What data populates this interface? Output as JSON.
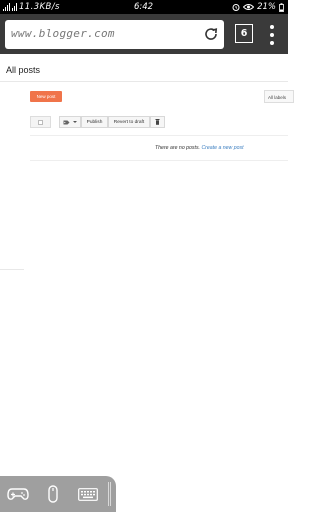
{
  "status_bar": {
    "speed": "11.3KB/s",
    "time": "6:42",
    "battery": "21%"
  },
  "browser": {
    "url": "www.blogger.com",
    "tab_count": "6"
  },
  "page": {
    "title": "All posts"
  },
  "actions": {
    "new_post": "New post",
    "all_labels": "All labels"
  },
  "toolbar": {
    "publish": "Publish",
    "revert": "Revert to draft"
  },
  "posts": {
    "empty_text": "There are no posts.",
    "create_link": "Create a new post"
  },
  "icons": {
    "reload": "reload-icon",
    "menu": "overflow-menu-icon",
    "label": "tag-icon",
    "trash": "trash-icon",
    "gamepad": "gamepad-icon",
    "mouse": "mouse-icon",
    "keyboard": "keyboard-icon"
  },
  "colors": {
    "new_post_button": "#f0744a",
    "link": "#3d7fc1",
    "browser_bar": "#3a3a3a"
  }
}
